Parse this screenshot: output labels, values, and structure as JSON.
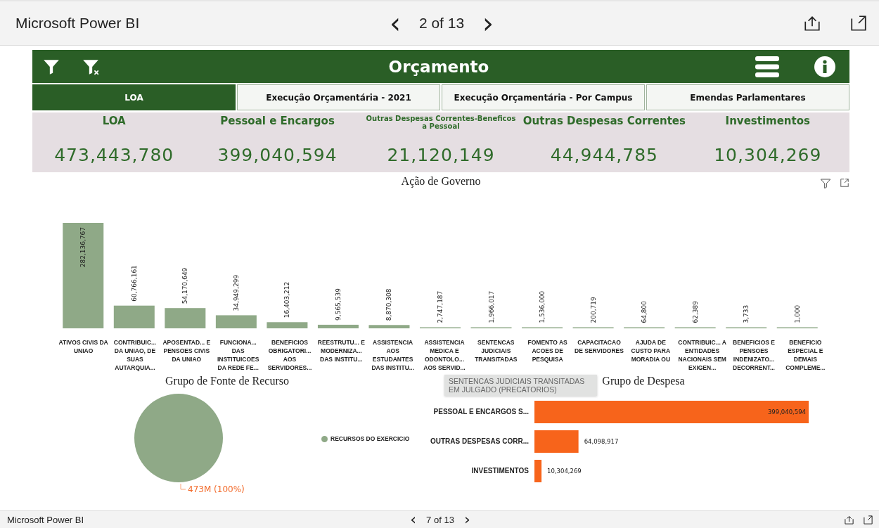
{
  "top_bar": {
    "title": "Microsoft Power BI",
    "page": "2 of 13",
    "prev": "‹",
    "next": "›"
  },
  "report": {
    "title": "Orçamento",
    "tabs": [
      {
        "label": "LOA",
        "selected": true
      },
      {
        "label": "Execução Orçamentária - 2021",
        "selected": false
      },
      {
        "label": "Execução Orçamentária - Por Campus",
        "selected": false
      },
      {
        "label": "Emendas Parlamentares",
        "selected": false
      }
    ],
    "kpis": [
      {
        "label": "LOA",
        "value": "473,443,780",
        "kind": "normal"
      },
      {
        "label": "Pessoal e Encargos",
        "value": "399,040,594",
        "kind": "normal"
      },
      {
        "label": "Outras Despesas Correntes-Beneficos a Pessoal",
        "value": "21,120,149",
        "kind": "compact"
      },
      {
        "label": "Outras Despesas Correntes",
        "value": "44,944,785",
        "kind": "normal"
      },
      {
        "label": "Investimentos",
        "value": "10,304,269",
        "kind": "normal"
      }
    ],
    "acao_chart": {
      "chart_data": {
        "type": "bar",
        "title": "Ação de Governo",
        "data_labels": true,
        "categories": [
          "ATIVOS CIVIS DA UNIAO",
          "CONTRIBUIC... DA UNIAO, DE SUAS AUTARQUIA...",
          "APOSENTAD... E PENSOES CIVIS DA UNIAO",
          "FUNCIONA... DAS INSTITUICOES DA REDE FE...",
          "BENEFICIOS OBRIGATORI... AOS SERVIDORES...",
          "REESTRUTU... E MODERNIZA... DAS INSTITU...",
          "ASSISTENCIA AOS ESTUDANTES DAS INSTITU...",
          "ASSISTENCIA MEDICA E ODONTOLO... AOS SERVID...",
          "SENTENCAS JUDICIAIS TRANSITADAS",
          "FOMENTO AS ACOES DE PESQUISA",
          "CAPACITACAO DE SERVIDORES",
          "AJUDA DE CUSTO PARA MORADIA OU",
          "CONTRIBUIC... A ENTIDADES NACIONAIS SEM EXIGEN...",
          "BENEFICIOS E PENSOES INDENIZATO... DECORRENT...",
          "BENEFICIO ESPECIAL E DEMAIS COMPLEME..."
        ],
        "series": [
          {
            "color": "#8fa987",
            "values": [
              282136767,
              60766161,
              54170649,
              34949299,
              16403212,
              9565539,
              8870308,
              2747187,
              1966017,
              1536000,
              200719,
              64800,
              62389,
              3733,
              1000
            ],
            "value_labels": [
              "282,136,767",
              "60,766,161",
              "54,170,649",
              "34,949,299",
              "16,403,212",
              "9,565,539",
              "8,870,308",
              "2,747,187",
              "1,966,017",
              "1,536,000",
              "200,719",
              "64,800",
              "62,389",
              "3,733",
              "1,000"
            ]
          }
        ]
      },
      "tooltip": "SENTENCAS JUDICIAIS TRANSITADAS EM JULGADO (PRECATORIOS)"
    },
    "fonte_chart": {
      "chart_data": {
        "type": "pie",
        "title": "Grupo de Fonte de Recurso",
        "categories": [
          "RECURSOS DO EXERCICIO"
        ],
        "series": [
          {
            "color": "#8fa987",
            "values": [
              100
            ]
          }
        ]
      },
      "slice_label": "473M (100%)"
    },
    "despesa_chart": {
      "chart_data": {
        "type": "bar",
        "orientation": "horizontal",
        "title": "Grupo de Despesa",
        "data_labels": true,
        "categories": [
          "PESSOAL E ENCARGOS S...",
          "OUTRAS DESPESAS CORR...",
          "INVESTIMENTOS"
        ],
        "series": [
          {
            "color": "#f7641b",
            "values": [
              399040594,
              64098917,
              10304269
            ],
            "value_labels": [
              "399,040,594",
              "64,098,917",
              "10,304,269"
            ]
          }
        ]
      }
    }
  },
  "bottom_bar": {
    "title": "Microsoft Power BI",
    "page": "7 of 13",
    "prev": "‹",
    "next": "›"
  }
}
